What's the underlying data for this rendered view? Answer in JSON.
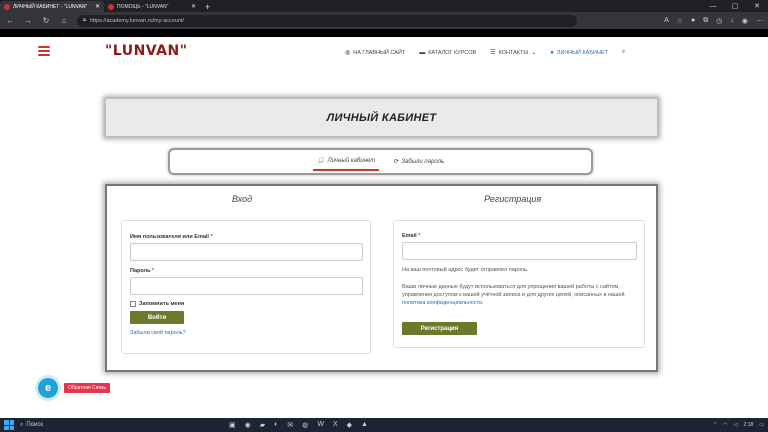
{
  "browser": {
    "tabs": [
      {
        "label": "ЛИЧНЫЙ КАБИНЕТ - \"LUNVAN\"",
        "active": true
      },
      {
        "label": "ПОМОЩЬ - \"LUNVAN\"",
        "active": false
      }
    ],
    "url": "https://academy.lunvan.ru/my-account/"
  },
  "site": {
    "logo": "\"LUNVAN\"",
    "nav": [
      {
        "label": "НА ГЛАВНЫЙ САЙТ",
        "icon": "globe-icon"
      },
      {
        "label": "КАТАЛОГ КУРСОВ",
        "icon": "folder-icon"
      },
      {
        "label": "КОНТАКТЫ",
        "icon": "list-icon"
      },
      {
        "label": "ЛИЧНЫЙ КАБИНЕТ",
        "icon": "user-icon"
      }
    ]
  },
  "page": {
    "title": "ЛИЧНЫЙ КАБИНЕТ",
    "subtabs": [
      {
        "label": "Личный кабинет",
        "active": true
      },
      {
        "label": "Забыли пароль",
        "active": false
      }
    ]
  },
  "login": {
    "heading": "Вход",
    "username_label": "Имя пользователя или Email",
    "password_label": "Пароль",
    "required_mark": "*",
    "remember_label": "Запомнить меня",
    "submit_label": "Войти",
    "forgot_link": "Забыли свой пароль?"
  },
  "register": {
    "heading": "Регистрация",
    "email_label": "Email",
    "required_mark": "*",
    "notice": "На ваш почтовый адрес будет отправлен пароль.",
    "privacy_text": "Ваши личные данные будут использоваться для упрощения вашей работы с сайтом, управления доступом к вашей учётной записи и для других целей, описанных в нашей",
    "privacy_link": "политика конфиденциальности",
    "privacy_end": ".",
    "submit_label": "Регистрация"
  },
  "widgets": {
    "chat_letter": "e",
    "feedback_label": "Обратная Связь"
  },
  "taskbar": {
    "search_label": "Поиск",
    "clock": "2:18"
  },
  "colors": {
    "brand": "#8b1a1a",
    "button": "#6b7a2a",
    "link": "#2a6fb3",
    "accent": "#c0392b"
  }
}
